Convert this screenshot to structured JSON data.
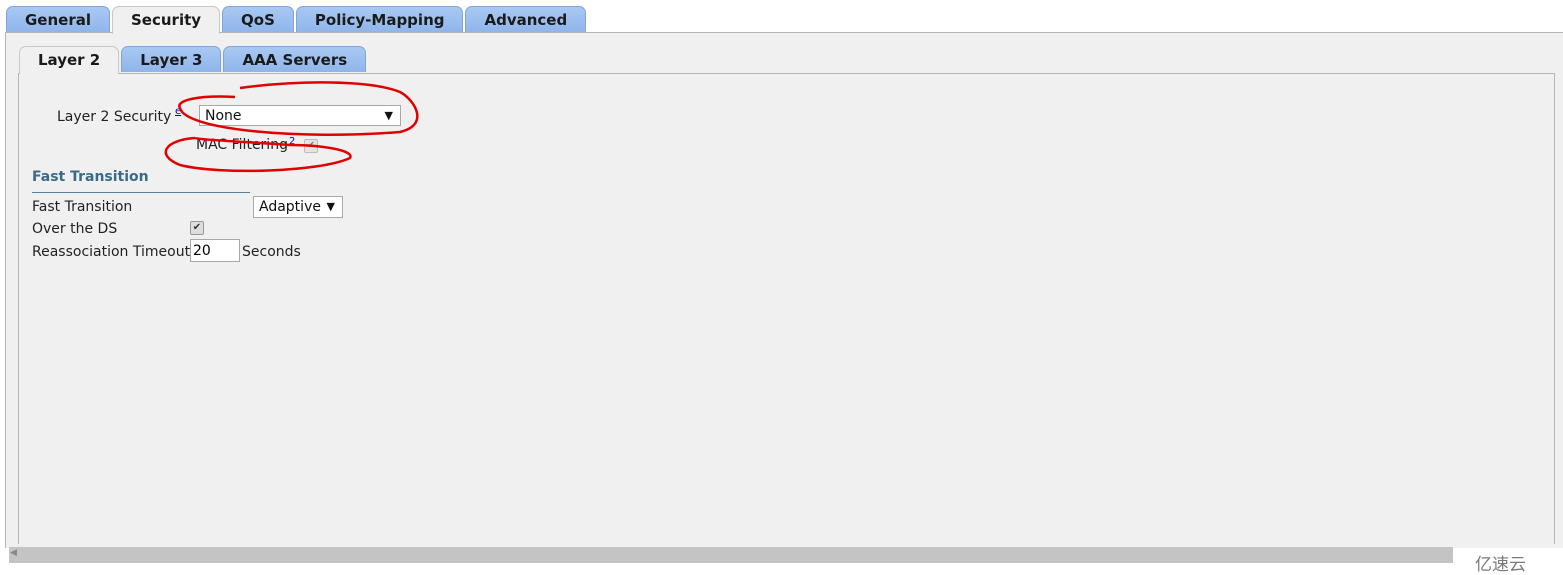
{
  "outer_tabs": [
    {
      "label": "General"
    },
    {
      "label": "Security",
      "active": true
    },
    {
      "label": "QoS"
    },
    {
      "label": "Policy-Mapping"
    },
    {
      "label": "Advanced"
    }
  ],
  "inner_tabs": [
    {
      "label": "Layer 2",
      "active": true
    },
    {
      "label": "Layer 3"
    },
    {
      "label": "AAA Servers"
    }
  ],
  "layer2": {
    "security_label": "Layer 2 Security",
    "security_value": "None",
    "help": "e",
    "mac_filtering_label": "MAC Filtering",
    "mac_help": "2",
    "mac_filtering_checked": true
  },
  "fast_transition": {
    "heading": "Fast Transition",
    "ft_label": "Fast Transition",
    "ft_value": "Adaptive",
    "over_ds_label": "Over the DS",
    "over_ds_checked": true,
    "reassoc_label": "Reassociation Timeout",
    "reassoc_value": "20",
    "reassoc_unit": "Seconds"
  },
  "arrow_glyph": "▼",
  "check_glyph": "✔",
  "annotation_color": "#e00000",
  "watermark": "亿速云"
}
